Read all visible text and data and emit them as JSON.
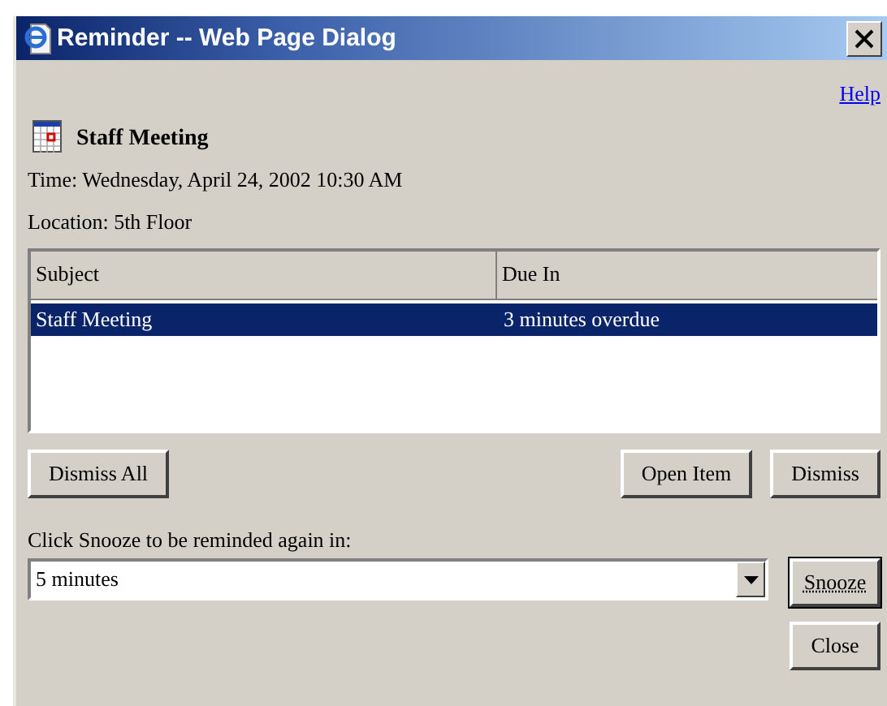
{
  "window": {
    "title": "Reminder -- Web Page Dialog"
  },
  "help_link": "Help",
  "reminder": {
    "subject": "Staff Meeting",
    "time": "Time: Wednesday, April 24, 2002 10:30 AM",
    "location": "Location: 5th Floor"
  },
  "table": {
    "columns": [
      "Subject",
      "Due In"
    ],
    "rows": [
      {
        "cells": [
          "Staff Meeting",
          "3 minutes overdue"
        ],
        "selected": true
      }
    ]
  },
  "list_buttons_left": [
    "Dismiss All"
  ],
  "list_buttons_right": [
    "Open Item",
    "Dismiss"
  ],
  "snooze_label": "Click Snooze to be reminded again in:",
  "snooze_dropdown": {
    "value": "5 minutes"
  },
  "side_buttons": [
    {
      "label": "Snooze",
      "default": true
    },
    {
      "label": "Close",
      "default": false
    }
  ]
}
